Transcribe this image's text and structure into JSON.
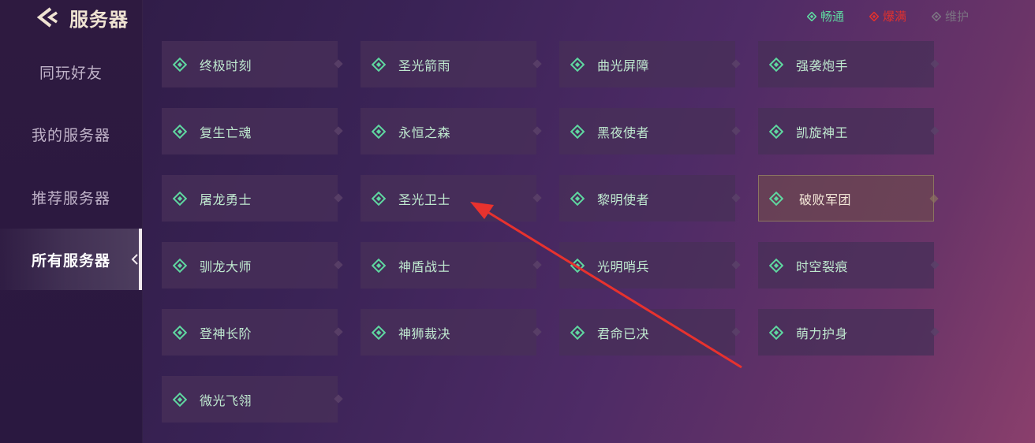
{
  "header": {
    "title": "服务器"
  },
  "nav": {
    "items": [
      {
        "label": "同玩好友"
      },
      {
        "label": "我的服务器"
      },
      {
        "label": "推荐服务器"
      },
      {
        "label": "所有服务器"
      }
    ],
    "active_index": 3
  },
  "legend": [
    {
      "label": "畅通",
      "color": "#5fd7a0"
    },
    {
      "label": "爆满",
      "color": "#e0312f"
    },
    {
      "label": "维护",
      "color": "#7b7382"
    }
  ],
  "servers": [
    {
      "name": "终极时刻",
      "status": "畅通"
    },
    {
      "name": "圣光箭雨",
      "status": "畅通"
    },
    {
      "name": "曲光屏障",
      "status": "畅通"
    },
    {
      "name": "强袭炮手",
      "status": "畅通"
    },
    {
      "name": "复生亡魂",
      "status": "畅通"
    },
    {
      "name": "永恒之森",
      "status": "畅通"
    },
    {
      "name": "黑夜使者",
      "status": "畅通"
    },
    {
      "name": "凯旋神王",
      "status": "畅通"
    },
    {
      "name": "屠龙勇士",
      "status": "畅通"
    },
    {
      "name": "圣光卫士",
      "status": "畅通"
    },
    {
      "name": "黎明使者",
      "status": "畅通"
    },
    {
      "name": "破败军团",
      "status": "畅通",
      "selected": true
    },
    {
      "name": "驯龙大师",
      "status": "畅通"
    },
    {
      "name": "神盾战士",
      "status": "畅通"
    },
    {
      "name": "光明哨兵",
      "status": "畅通"
    },
    {
      "name": "时空裂痕",
      "status": "畅通"
    },
    {
      "name": "登神长阶",
      "status": "畅通"
    },
    {
      "name": "神狮裁决",
      "status": "畅通"
    },
    {
      "name": "君命已决",
      "status": "畅通"
    },
    {
      "name": "萌力护身",
      "status": "畅通"
    },
    {
      "name": "微光飞翎",
      "status": "畅通"
    }
  ],
  "colors": {
    "accent_green": "#5fd7a0",
    "server_text": "#bfe8cf",
    "annotation_arrow": "#e8322e"
  }
}
